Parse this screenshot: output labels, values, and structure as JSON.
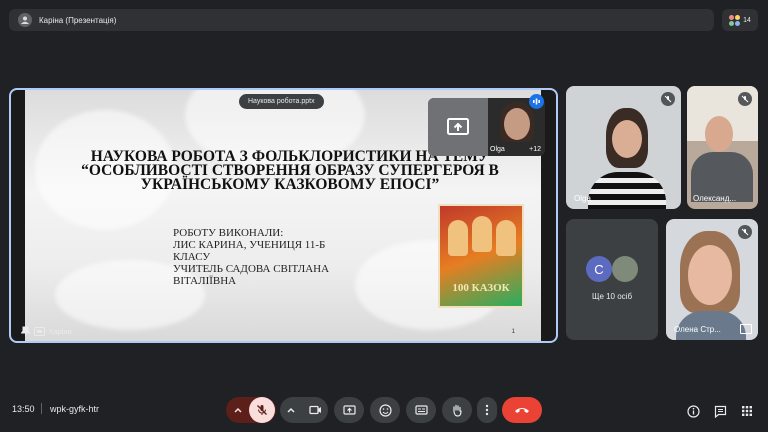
{
  "topbar": {
    "title": "Каріна (Презентація)"
  },
  "people": {
    "count": "14"
  },
  "stage": {
    "file_chip": "Наукова робота.pptx",
    "presenter": "Каріна",
    "pip_name": "Olga",
    "pip_extra": "+12"
  },
  "slide": {
    "heading": "НАУКОВА РОБОТА З ФОЛЬКЛОРИСТИКИ НА ТЕМУ “ОСОБЛИВОСТІ СТВОРЕННЯ ОБРАЗУ СУПЕРГЕРОЯ В УКРАЇНСЬКОМУ КАЗКОВОМУ ЕПОСІ”",
    "body_lines": [
      "РОБОТУ ВИКОНАЛИ:",
      "ЛИС КАРИНА, УЧЕНИЦЯ 11-Б",
      "КЛАСУ",
      "УЧИТЕЛЬ САДОВА СВІТЛАНА",
      "ВІТАЛІЇВНА"
    ],
    "book_title": "100 КАЗОК",
    "page_number": "1"
  },
  "tiles": {
    "olga": "Olga",
    "oleksandr": "Олександ...",
    "more_initial": "C",
    "more_label": "Ще 10 осіб",
    "olena": "Олена Стр..."
  },
  "bottom": {
    "time": "13:50",
    "meeting_code": "wpk-gyfk-htr"
  },
  "colors": {
    "background": "#202124",
    "surface": "#3c4043",
    "accent": "#aecbfa",
    "end_call": "#ea4335",
    "mic_off": "#f9dedc"
  }
}
